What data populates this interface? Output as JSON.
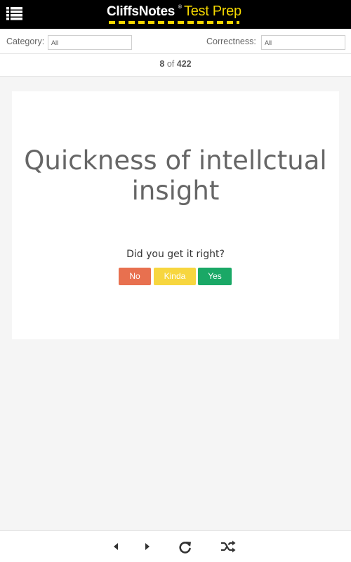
{
  "header": {
    "brand_primary": "CliffsNotes",
    "brand_reg": "®",
    "brand_secondary": "Test Prep",
    "menu_icon": "list-menu-icon",
    "colors": {
      "background": "#000000",
      "accent": "#f5d800"
    }
  },
  "filters": {
    "category_label": "Category:",
    "category_value": "All",
    "correctness_label": "Correctness:",
    "correctness_value": "All"
  },
  "counter": {
    "current": "8",
    "separator": "of",
    "total": "422"
  },
  "card": {
    "term": "Quickness of intellctual insight",
    "question": "Did you get it right?",
    "buttons": {
      "no": "No",
      "kinda": "Kinda",
      "yes": "Yes"
    },
    "colors": {
      "no": "#e8704f",
      "kinda": "#f7d63f",
      "yes": "#1aa866"
    }
  },
  "footer": {
    "icons": [
      "previous-icon",
      "next-icon",
      "restart-icon",
      "shuffle-icon"
    ]
  }
}
